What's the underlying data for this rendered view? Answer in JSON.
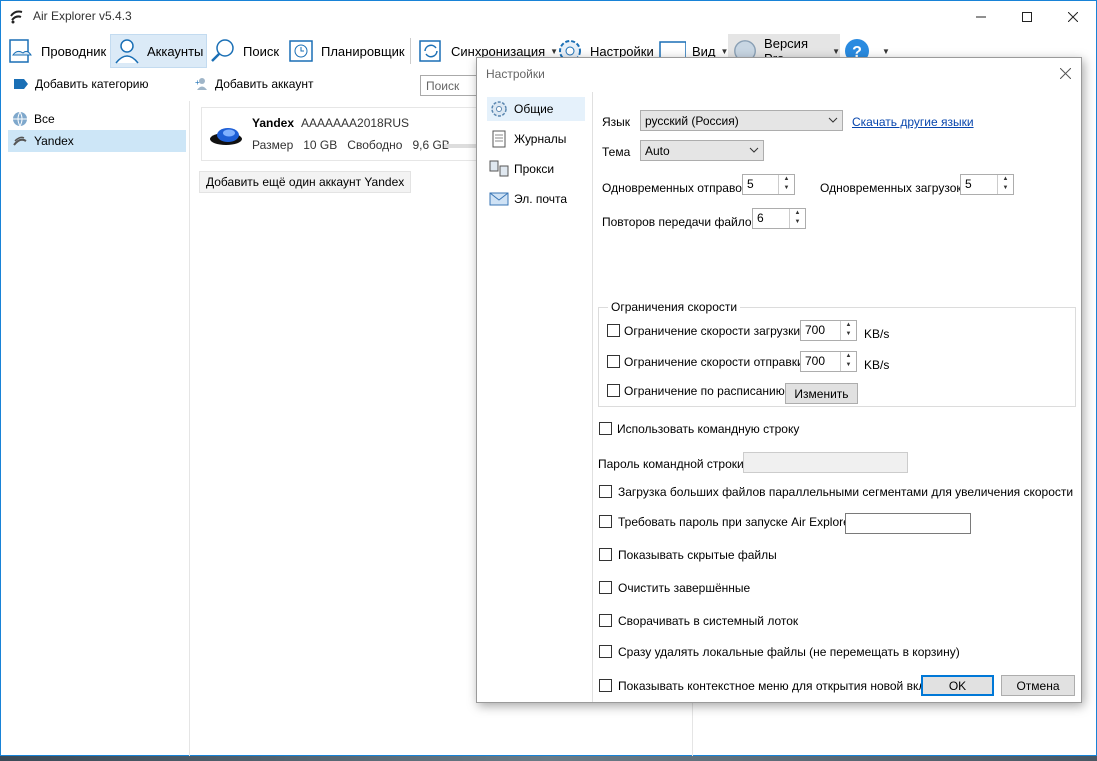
{
  "app": {
    "title": "Air Explorer v5.4.3"
  },
  "toolbar": {
    "explorer": "Проводник",
    "accounts": "Аккаунты",
    "search": "Поиск",
    "scheduler": "Планировщик",
    "sync": "Синхронизация",
    "settings": "Настройки",
    "view": "Вид",
    "pro": "Версия Pro"
  },
  "subbar": {
    "add_category": "Добавить категорию",
    "add_account": "Добавить аккаунт",
    "search_placeholder": "Поиск"
  },
  "sidebar": {
    "items": [
      {
        "label": "Все",
        "icon": "globe-icon"
      },
      {
        "label": "Yandex",
        "icon": "yandex-icon"
      }
    ]
  },
  "account": {
    "name": "Yandex",
    "login": "AAAAAAA2018RUS",
    "size_label": "Размер",
    "size_value": "10 GB",
    "free_label": "Свободно",
    "free_value": "9,6 GB",
    "add_another": "Добавить ещё один аккаунт Yandex"
  },
  "dialog": {
    "title": "Настройки",
    "nav": [
      {
        "label": "Общие",
        "icon": "gear-icon"
      },
      {
        "label": "Журналы",
        "icon": "document-icon"
      },
      {
        "label": "Прокси",
        "icon": "network-icon"
      },
      {
        "label": "Эл. почта",
        "icon": "mail-icon"
      }
    ],
    "language_label": "Язык",
    "language_value": "русский (Россия)",
    "download_languages": "Скачать другие языки",
    "theme_label": "Тема",
    "theme_value": "Auto",
    "concurrent_uploads_label": "Одновременных отправок",
    "concurrent_uploads_value": "5",
    "concurrent_downloads_label": "Одновременных загрузок",
    "concurrent_downloads_value": "5",
    "retries_label": "Повторов передачи файлов",
    "retries_value": "6",
    "speed_group": "Ограничения скорости",
    "download_limit_label": "Ограничение скорости загрузки",
    "download_limit_value": "700",
    "upload_limit_label": "Ограничение скорости отправки",
    "upload_limit_value": "700",
    "unit": "KB/s",
    "schedule_limit_label": "Ограничение по расписанию",
    "change_button": "Изменить",
    "use_cmdline": "Использовать командную строку",
    "cmdline_password": "Пароль командной строки",
    "parallel_segments": "Загрузка больших файлов параллельными сегментами для увеличения скорости",
    "require_password": "Требовать пароль при запуске Air Explorer",
    "show_hidden": "Показывать скрытые файлы",
    "clear_completed": "Очистить завершённые",
    "minimize_tray": "Сворачивать в системный лоток",
    "delete_local": "Сразу удалять локальные файлы (не перемещать в корзину)",
    "context_menu": "Показывать контекстное меню для открытия новой вкладки",
    "ok": "OK",
    "cancel": "Отмена"
  },
  "colors": {
    "accent": "#0078d7",
    "selection": "#cde6f7",
    "link": "#0645ad"
  }
}
